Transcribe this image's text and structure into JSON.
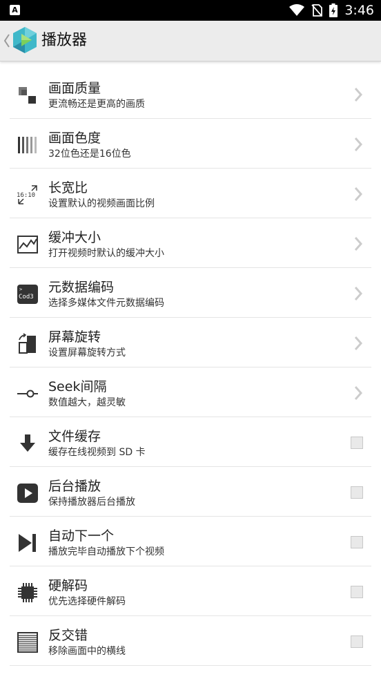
{
  "statusbar": {
    "notification_letter": "A",
    "time": "3:46"
  },
  "header": {
    "title": "播放器",
    "back_icon": "chevron-left-icon",
    "logo_icon": "app-logo-icon"
  },
  "settings": [
    {
      "title": "画面质量",
      "subtitle": "更流畅还是更高的画质",
      "icon": "quality-icon",
      "control": "chevron"
    },
    {
      "title": "画面色度",
      "subtitle": "32位色还是16位色",
      "icon": "color-depth-icon",
      "control": "chevron"
    },
    {
      "title": "长宽比",
      "subtitle": "设置默认的视频画面比例",
      "icon": "aspect-ratio-icon",
      "icon_text": "16:10",
      "control": "chevron"
    },
    {
      "title": "缓冲大小",
      "subtitle": "打开视频时默认的缓冲大小",
      "icon": "buffer-chart-icon",
      "control": "chevron"
    },
    {
      "title": "元数据编码",
      "subtitle": "选择多媒体文件元数据编码",
      "icon": "encoding-icon",
      "icon_text": "Cod3",
      "control": "chevron"
    },
    {
      "title": "屏幕旋转",
      "subtitle": "设置屏幕旋转方式",
      "icon": "screen-rotation-icon",
      "control": "chevron"
    },
    {
      "title": "Seek间隔",
      "subtitle": "数值越大，越灵敏",
      "icon": "seek-slider-icon",
      "control": "chevron"
    },
    {
      "title": "文件缓存",
      "subtitle": "缓存在线视频到 SD 卡",
      "icon": "download-icon",
      "control": "checkbox",
      "checked": false
    },
    {
      "title": "后台播放",
      "subtitle": "保持播放器后台播放",
      "icon": "play-icon",
      "control": "checkbox",
      "checked": false
    },
    {
      "title": "自动下一个",
      "subtitle": "播放完毕自动播放下个视频",
      "icon": "skip-next-icon",
      "control": "checkbox",
      "checked": false
    },
    {
      "title": "硬解码",
      "subtitle": "优先选择硬件解码",
      "icon": "chip-icon",
      "control": "checkbox",
      "checked": false
    },
    {
      "title": "反交错",
      "subtitle": "移除画面中的横线",
      "icon": "deinterlace-icon",
      "control": "checkbox",
      "checked": false
    }
  ],
  "colors": {
    "statusbar_bg": "#000000",
    "actionbar_bg": "#ececec",
    "icon_color": "#333333",
    "logo_teal": "#3fb8c9",
    "logo_green": "#7ccf5a"
  }
}
